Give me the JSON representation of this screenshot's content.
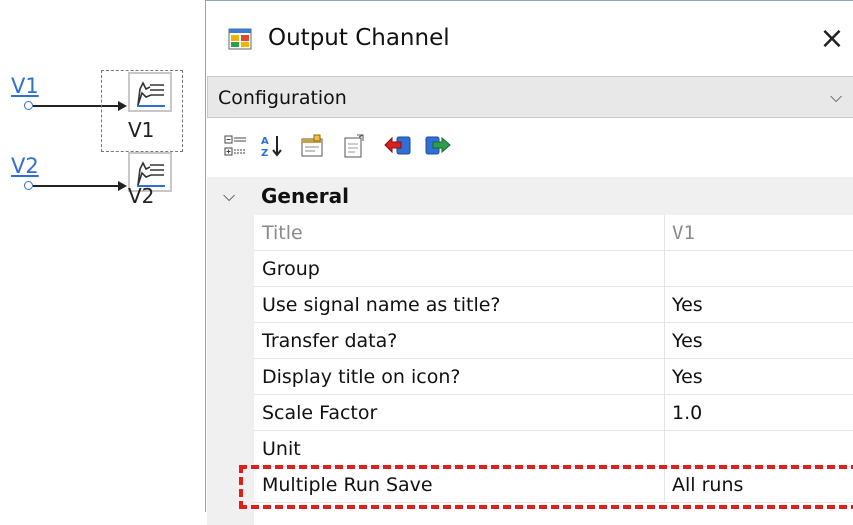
{
  "schematic": {
    "signals": [
      {
        "label": "V1",
        "block_name": "V1"
      },
      {
        "label": "V2",
        "block_name": "V2"
      }
    ]
  },
  "dialog": {
    "title": "Output Channel",
    "close_glyph": "×",
    "config_combo": {
      "value": "Configuration",
      "arrow": "⌵"
    },
    "toolbar": [
      {
        "icon": "categorized-icon"
      },
      {
        "icon": "sort-alphabetical-icon"
      },
      {
        "icon": "property-pages-icon"
      },
      {
        "icon": "copy-properties-icon"
      },
      {
        "icon": "import-red-arrow-icon"
      },
      {
        "icon": "export-green-arrow-icon"
      }
    ]
  },
  "property_grid": {
    "category": {
      "label": "General",
      "chevron": "⌵"
    },
    "rows": [
      {
        "name": "Title",
        "value": "V1",
        "disabled": true
      },
      {
        "name": "Group",
        "value": ""
      },
      {
        "name": "Use signal name as title?",
        "value": "Yes"
      },
      {
        "name": "Transfer data?",
        "value": "Yes"
      },
      {
        "name": "Display title on icon?",
        "value": "Yes"
      },
      {
        "name": "Scale Factor",
        "value": "1.0"
      },
      {
        "name": "Unit",
        "value": ""
      },
      {
        "name": "Multiple Run Save",
        "value": "All runs",
        "highlighted": true
      }
    ]
  },
  "colors": {
    "signal_blue": "#2f6fd6",
    "highlight_red": "#e0201a",
    "category_bg": "#f0f0f0"
  }
}
